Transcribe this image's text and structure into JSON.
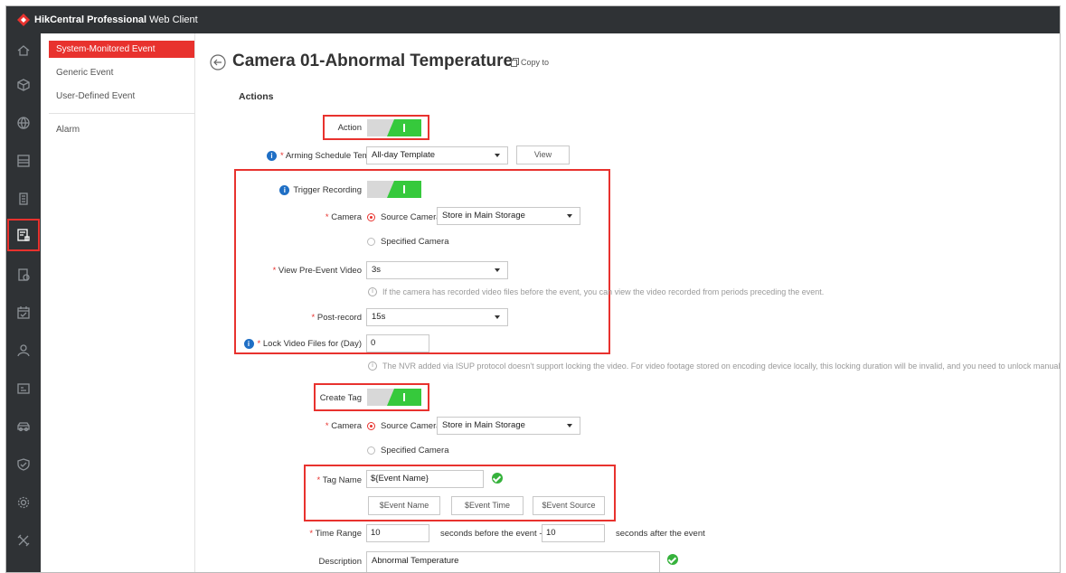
{
  "app": {
    "brand_bold": "HikCentral Professional",
    "brand_rest": "Web Client"
  },
  "submenu": {
    "items": [
      {
        "label": "System-Monitored Event",
        "active": true
      },
      {
        "label": "Generic Event"
      },
      {
        "label": "User-Defined Event"
      },
      {
        "label": "Alarm"
      }
    ]
  },
  "nav_icons": [
    "home-icon",
    "cube-icon",
    "globe-icon",
    "storage-icon",
    "building-icon",
    "event-config-icon",
    "record-icon",
    "calendar-icon",
    "person-icon",
    "id-card-icon",
    "vehicle-icon",
    "shield-icon",
    "gear-icon",
    "tools-icon"
  ],
  "page": {
    "title": "Camera 01-Abnormal Temperature",
    "copy_to": "Copy to",
    "section": "Actions"
  },
  "form": {
    "action_label": "Action",
    "arming_label": "Arming Schedule Template",
    "arming_value": "All-day Template",
    "view_button": "View",
    "trigger_recording_label": "Trigger Recording",
    "camera_label": "Camera",
    "source_camera": "Source Camera",
    "storage_value": "Store in Main Storage",
    "specified_camera": "Specified Camera",
    "pre_event_label": "View Pre-Event Video",
    "pre_event_value": "3s",
    "pre_event_hint": "If the camera has recorded video files before the event, you can view the video recorded from periods preceding the event.",
    "post_record_label": "Post-record",
    "post_record_value": "15s",
    "lock_label": "Lock Video Files for (Day)",
    "lock_value": "0",
    "lock_hint": "The NVR added via ISUP protocol doesn't support locking the video. For video footage stored on encoding device locally, this locking duration will be invalid, and you need to unlock manually.",
    "create_tag_label": "Create Tag",
    "camera2_label": "Camera",
    "source_camera2": "Source Camera",
    "storage_value2": "Store in Main Storage",
    "specified_camera2": "Specified Camera",
    "tag_name_label": "Tag Name",
    "tag_name_value": "${Event Name}",
    "tag_btn_event_name": "$Event Name",
    "tag_btn_event_time": "$Event Time",
    "tag_btn_event_source": "$Event Source",
    "time_range_label": "Time Range",
    "time_before_value": "10",
    "time_before_text": "seconds before the event -",
    "time_after_value": "10",
    "time_after_text": "seconds after the event",
    "description_label": "Description",
    "description_value": "Abnormal Temperature"
  },
  "colors": {
    "accent": "#e8322e",
    "toggle_on": "#36c93c",
    "nav_bg": "#2f3235",
    "info": "#1f6fc5"
  }
}
